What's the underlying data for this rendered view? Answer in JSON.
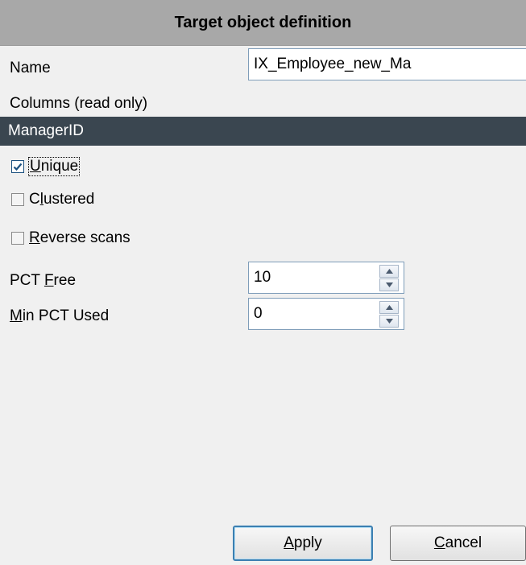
{
  "header": {
    "title": "Target object definition"
  },
  "form": {
    "name_label": "Name",
    "name_value": "IX_Employee_new_Ma",
    "columns_label": "Columns (read only)",
    "columns_value": "ManagerID",
    "unique": {
      "label_underlined": "U",
      "label_rest": "nique",
      "checked": true
    },
    "clustered": {
      "label_pre": "C",
      "label_underlined": "l",
      "label_rest": "ustered",
      "checked": false
    },
    "reverse_scans": {
      "label_underlined": "R",
      "label_rest": "everse scans",
      "checked": false
    },
    "pct_free": {
      "label_pre": "PCT ",
      "label_underlined": "F",
      "label_rest": "ree",
      "value": "10"
    },
    "min_pct_used": {
      "label_underlined": "M",
      "label_rest": "in PCT Used",
      "value": "0"
    }
  },
  "buttons": {
    "apply": {
      "underlined": "A",
      "rest": "pply"
    },
    "cancel": {
      "underlined": "C",
      "rest": "ancel"
    }
  },
  "colors": {
    "header_bg": "#a8a8a8",
    "columns_bg": "#3a4650",
    "check_color": "#1c5180",
    "focus_button_border": "#3c7fb1"
  },
  "icons": {
    "spin_up": "spin-up-arrow-icon",
    "spin_down": "spin-down-arrow-icon",
    "check": "checkmark-icon"
  }
}
